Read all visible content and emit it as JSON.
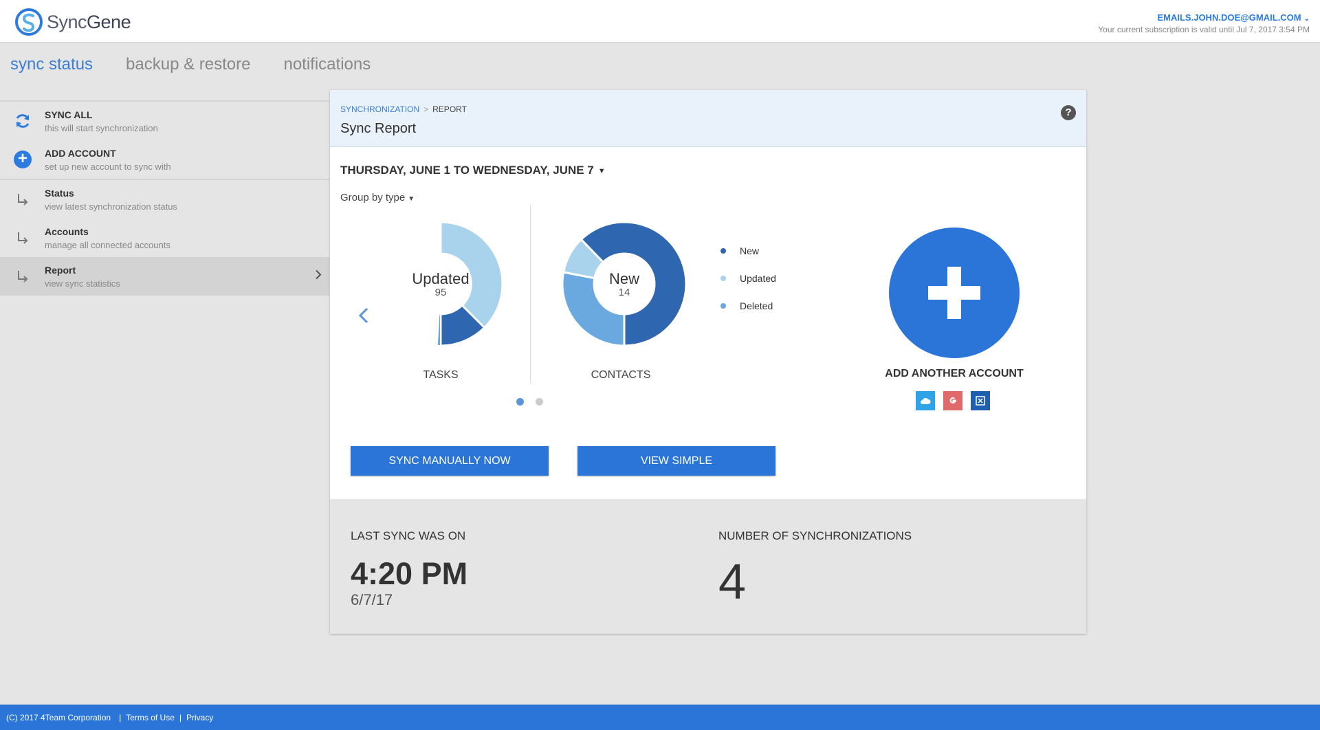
{
  "app": {
    "logo_text_1": "Sync",
    "logo_text_2": "Gene"
  },
  "header": {
    "account_email": "EMAILS.JOHN.DOE@GMAIL.COM",
    "subscription": "Your current subscription is valid until Jul 7, 2017 3:54 PM"
  },
  "tabs": [
    {
      "label": "sync status",
      "active": true
    },
    {
      "label": "backup & restore",
      "active": false
    },
    {
      "label": "notifications",
      "active": false
    }
  ],
  "sidebar": {
    "actions": [
      {
        "title": "SYNC ALL",
        "subtitle": "this will start synchronization",
        "icon": "sync-icon"
      },
      {
        "title": "ADD ACCOUNT",
        "subtitle": "set up new account to sync with",
        "icon": "plus-circle-icon"
      }
    ],
    "nav": [
      {
        "title": "Status",
        "subtitle": "view latest synchronization status",
        "icon": "subdirectory-arrow-icon"
      },
      {
        "title": "Accounts",
        "subtitle": "manage all connected accounts",
        "icon": "subdirectory-arrow-icon"
      },
      {
        "title": "Report",
        "subtitle": "view sync statistics",
        "icon": "subdirectory-arrow-icon",
        "active": true
      }
    ]
  },
  "card": {
    "breadcrumb": {
      "parent": "SYNCHRONIZATION",
      "separator": ">",
      "current": "REPORT"
    },
    "title": "Sync Report",
    "help": "?",
    "date_range": "THURSDAY, JUNE 1 TO WEDNESDAY, JUNE 7",
    "group_by": "Group by type"
  },
  "charts": {
    "tasks": {
      "center_label": "Updated",
      "center_value": "95",
      "caption": "TASKS"
    },
    "contacts": {
      "center_label": "New",
      "center_value": "14",
      "caption": "CONTACTS"
    }
  },
  "legend": [
    {
      "label": "New",
      "color": "#2f66b0"
    },
    {
      "label": "Updated",
      "color": "#a9d3ec"
    },
    {
      "label": "Deleted",
      "color": "#6aa9e0"
    }
  ],
  "add_account": {
    "label": "ADD ANOTHER ACCOUNT",
    "providers": [
      "icloud-icon",
      "google-icon",
      "exchange-icon"
    ]
  },
  "buttons": {
    "sync_now": "SYNC MANUALLY NOW",
    "view_simple": "VIEW SIMPLE"
  },
  "stats": {
    "last_sync_label": "LAST SYNC WAS ON",
    "last_sync_time": "4:20 PM",
    "last_sync_date": "6/7/17",
    "count_label": "NUMBER OF SYNCHRONIZATIONS",
    "count_value": "4"
  },
  "footer": {
    "copyright": "(C) 2017  4Team Corporation",
    "terms": "Terms of Use",
    "privacy": "Privacy",
    "separator": "|"
  },
  "colors": {
    "accent": "#2b74d8",
    "new": "#2f66b0",
    "updated": "#a9d3ec",
    "deleted": "#6aa9e0"
  }
}
